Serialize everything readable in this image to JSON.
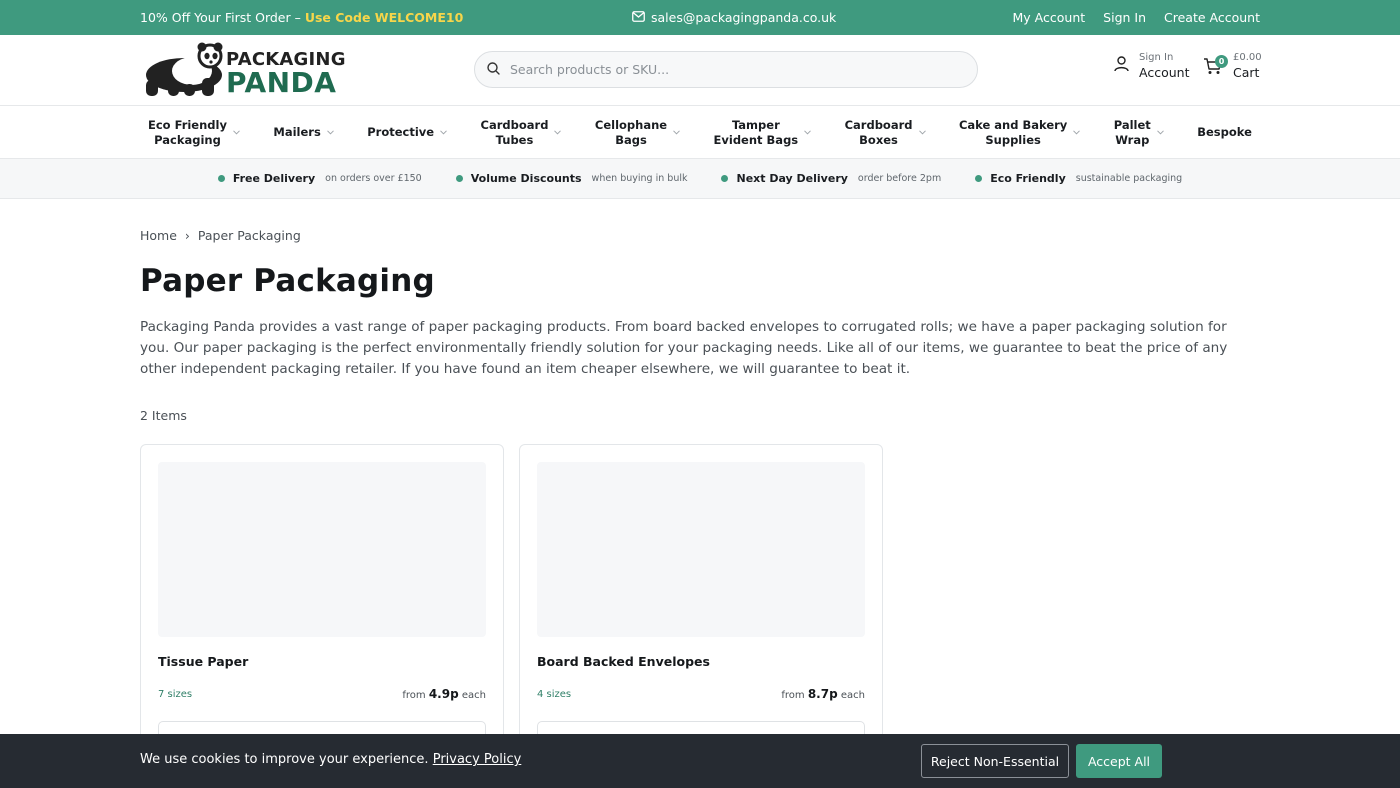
{
  "topbar": {
    "promo_text": "10% Off Your First Order – ",
    "promo_code": "Use Code WELCOME10",
    "email": "sales@packagingpanda.co.uk",
    "links": [
      "My Account",
      "Sign In",
      "Create Account"
    ]
  },
  "header": {
    "logo_line1": "PACKAGING",
    "logo_line2": "PANDA",
    "search_placeholder": "Search products or SKU...",
    "account_small": "Sign In",
    "account_big": "Account",
    "cart_count": "0",
    "cart_total": "£0.00",
    "cart_label": "Cart"
  },
  "nav": [
    {
      "label": "Eco Friendly\nPackaging",
      "has_menu": true
    },
    {
      "label": "Mailers",
      "has_menu": true
    },
    {
      "label": "Protective",
      "has_menu": true
    },
    {
      "label": "Cardboard\nTubes",
      "has_menu": true
    },
    {
      "label": "Cellophane\nBags",
      "has_menu": true
    },
    {
      "label": "Tamper\nEvident Bags",
      "has_menu": true
    },
    {
      "label": "Cardboard\nBoxes",
      "has_menu": true
    },
    {
      "label": "Cake and Bakery\nSupplies",
      "has_menu": true
    },
    {
      "label": "Pallet\nWrap",
      "has_menu": true
    },
    {
      "label": "Bespoke",
      "has_menu": false
    }
  ],
  "benefits": [
    {
      "title": "Free Delivery",
      "sub": "on orders over £150"
    },
    {
      "title": "Volume Discounts",
      "sub": "when buying in bulk"
    },
    {
      "title": "Next Day Delivery",
      "sub": "order before 2pm"
    },
    {
      "title": "Eco Friendly",
      "sub": "sustainable packaging"
    }
  ],
  "breadcrumb": {
    "home": "Home",
    "sep": "›",
    "current": "Paper Packaging"
  },
  "page": {
    "title": "Paper Packaging",
    "description": "Packaging Panda provides a vast range of paper packaging products. From board backed envelopes to corrugated rolls; we have a paper packaging solution for you. Our paper packaging is the perfect environmentally friendly solution for your packaging needs. Like all of our items, we guarantee to beat the price of any other independent packaging retailer. If you have found an item cheaper elsewhere, we will guarantee to beat it.",
    "item_count": "2 Items"
  },
  "products": [
    {
      "name": "Tissue Paper",
      "sizes": "7 sizes",
      "price_prefix": "from",
      "price": "4.9p",
      "price_suffix": "each"
    },
    {
      "name": "Board Backed Envelopes",
      "sizes": "4 sizes",
      "price_prefix": "from",
      "price": "8.7p",
      "price_suffix": "each"
    }
  ],
  "cookie": {
    "message": "We use cookies to improve your experience. ",
    "policy_link": "Privacy Policy",
    "reject_label": "Reject Non-Essential",
    "accept_label": "Accept All"
  },
  "colors": {
    "brand_green": "#3f9a7f",
    "logo_green": "#1f6b50",
    "promo_yellow": "#f7d64a",
    "cookie_bg": "#262b32"
  }
}
